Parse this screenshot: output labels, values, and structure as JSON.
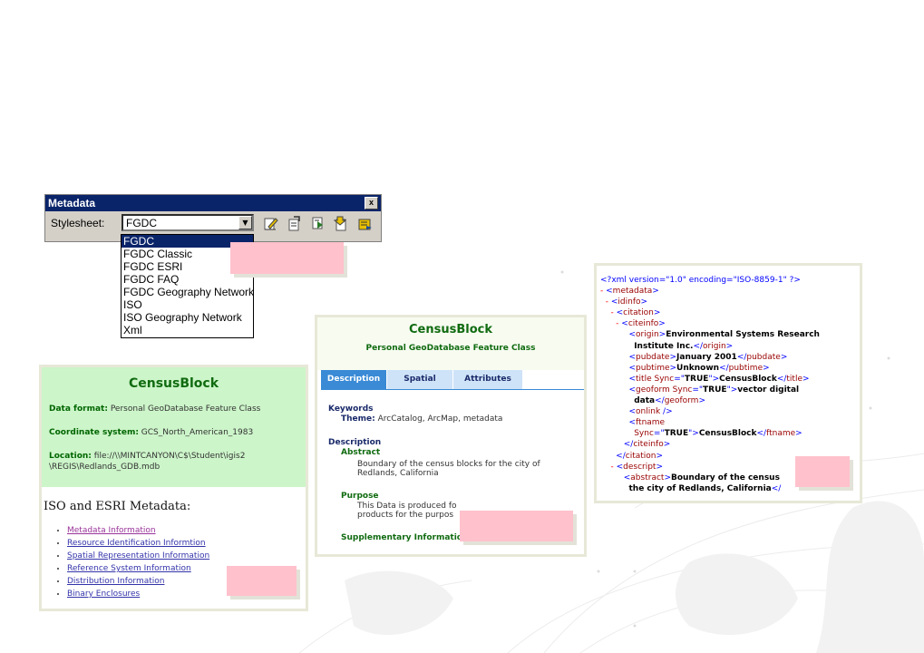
{
  "toolbar": {
    "title": "Metadata",
    "close_label": "x",
    "stylesheet_label": "Stylesheet:",
    "stylesheet_value": "FGDC",
    "dropdown_arrow": "▼",
    "icons": [
      "edit-metadata-icon",
      "create-update-icon",
      "import-icon",
      "export-icon",
      "properties-icon"
    ]
  },
  "dropdown": {
    "options": [
      "FGDC",
      "FGDC Classic",
      "FGDC ESRI",
      "FGDC FAQ",
      "FGDC Geography Network",
      "ISO",
      "ISO Geography Network",
      "Xml"
    ],
    "selected": "FGDC"
  },
  "panel_iso": {
    "title": "CensusBlock",
    "data_format_label": "Data format:",
    "data_format_value": "Personal GeoDatabase Feature Class",
    "coord_label": "Coordinate system:",
    "coord_value": "GCS_North_American_1983",
    "location_label": "Location:",
    "location_value": "file://\\\\MINTCANYON\\C$\\Student\\igis2 \\REGIS\\Redlands_GDB.mdb",
    "section_title": "ISO and ESRI Metadata:",
    "links": [
      "Metadata Information",
      "Resource Identification Informtion",
      "Spatial Representation Information",
      "Reference System Information",
      "Distribution Information",
      "Binary Enclosures"
    ]
  },
  "panel_fgdc": {
    "title": "CensusBlock",
    "subtitle": "Personal GeoDatabase Feature Class",
    "tabs": [
      "Description",
      "Spatial",
      "Attributes"
    ],
    "active_tab": "Description",
    "keywords_heading": "Keywords",
    "theme_label": "Theme:",
    "theme_value": "ArcCatalog, ArcMap, metadata",
    "description_heading": "Description",
    "abstract_heading": "Abstract",
    "abstract_text_1": "Boundary of the census blocks for the city of",
    "abstract_text_2": "Redlands, California",
    "purpose_heading": "Purpose",
    "purpose_text_1": "This Data is produced fo",
    "purpose_text_2": "products for the purpos",
    "supplementary_heading": "Supplementary Information"
  },
  "panel_xml": {
    "declaration": "<?xml version=\"1.0\" encoding=\"ISO-8859-1\" ?>",
    "origin": "Environmental Systems Research",
    "origin_2": "Institute Inc.",
    "pubdate": "January 2001",
    "pubtime": "Unknown",
    "title": "CensusBlock",
    "geoform": "vector digital",
    "geoform_2": "data",
    "ftname": "CensusBlock",
    "abstract_1": "Boundary of the census",
    "abstract_2": "the city of Redlands, California"
  },
  "colors": {
    "title_bar": "#0a246a",
    "dialog_face": "#d4d0c8",
    "green_header": "#ccf5c9",
    "green_text": "#106b10",
    "active_tab": "#3a8ad6",
    "inactive_tab": "#cfe3f8",
    "placeholder_pink": "#ffc1cc"
  }
}
